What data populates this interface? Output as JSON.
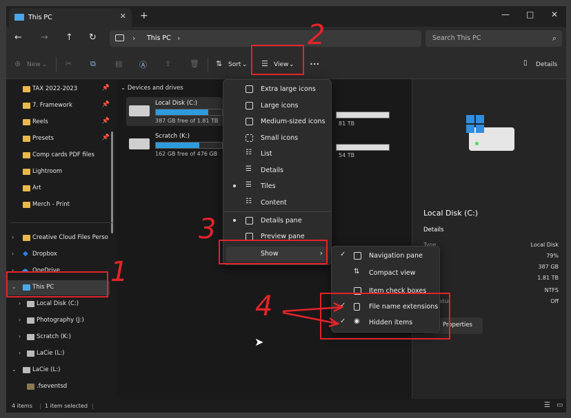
{
  "window": {
    "tab_title": "This PC",
    "new_tab": "+",
    "minimize": "—",
    "maximize": "□",
    "close": "✕"
  },
  "address": {
    "location": "This PC",
    "search_placeholder": "Search This PC"
  },
  "toolbar": {
    "new_label": "New",
    "sort_label": "Sort",
    "view_label": "View",
    "more_label": "•••",
    "details_label": "Details"
  },
  "nav": {
    "items": [
      {
        "label": "TAX 2022-2023",
        "pinned": true
      },
      {
        "label": "7. Framework",
        "pinned": true
      },
      {
        "label": "Reels",
        "pinned": true
      },
      {
        "label": "Presets",
        "pinned": true
      },
      {
        "label": "Comp cards PDF files",
        "pinned": false
      },
      {
        "label": "Lightroom",
        "pinned": false
      },
      {
        "label": "Art",
        "pinned": false
      },
      {
        "label": "Merch - Print",
        "pinned": false
      },
      {
        "label": "Creative Cloud Files Personal",
        "pinned": false
      },
      {
        "label": "Dropbox",
        "pinned": false
      },
      {
        "label": "OneDrive",
        "pinned": false
      },
      {
        "label": "This PC",
        "pinned": false
      },
      {
        "label": "Local Disk (C:)",
        "pinned": false
      },
      {
        "label": "Photography (J:)",
        "pinned": false
      },
      {
        "label": "Scratch (K:)",
        "pinned": false
      },
      {
        "label": "LaCie (L:)",
        "pinned": false
      },
      {
        "label": "LaCie (L:)",
        "pinned": false
      },
      {
        "label": ".fseventsd",
        "pinned": false
      }
    ]
  },
  "content": {
    "group_header": "Devices and drives",
    "drives": [
      {
        "name": "Local Disk (C:)",
        "free": "387 GB free of 1.81 TB",
        "used_fraction": 0.79
      },
      {
        "name": "Scratch (K:)",
        "free": "162 GB free of 476 GB",
        "used_fraction": 0.66
      }
    ],
    "partial_sizes": [
      "81 TB",
      "54 TB"
    ]
  },
  "view_menu": {
    "items": [
      {
        "label": "Extra large icons",
        "bullet": false
      },
      {
        "label": "Large icons",
        "bullet": false
      },
      {
        "label": "Medium-sized icons",
        "bullet": false
      },
      {
        "label": "Small icons",
        "bullet": false
      },
      {
        "label": "List",
        "bullet": false
      },
      {
        "label": "Details",
        "bullet": false
      },
      {
        "label": "Tiles",
        "bullet": true
      },
      {
        "label": "Content",
        "bullet": false
      },
      {
        "label": "Details pane",
        "bullet": true
      },
      {
        "label": "Preview pane",
        "bullet": false
      },
      {
        "label": "Show",
        "bullet": false
      }
    ]
  },
  "show_menu": {
    "items": [
      {
        "label": "Navigation pane",
        "checked": true
      },
      {
        "label": "Compact view",
        "checked": false
      },
      {
        "label": "Item check boxes",
        "checked": false
      },
      {
        "label": "File name extensions",
        "checked": true
      },
      {
        "label": "Hidden items",
        "checked": true
      }
    ]
  },
  "details_pane": {
    "title": "Local Disk (C:)",
    "section": "Details",
    "rows": [
      {
        "label": "Type",
        "value": "Local Disk"
      },
      {
        "label": "used",
        "value": "79%"
      },
      {
        "label": "free",
        "value": "387 GB"
      },
      {
        "label": "ze",
        "value": "1.81 TB"
      },
      {
        "label": "stem",
        "value": "NTFS"
      },
      {
        "label": "ker status",
        "value": "Off"
      }
    ],
    "properties_label": "Properties"
  },
  "status": {
    "count": "4 items",
    "selected": "1 item selected"
  },
  "annotations": [
    "1",
    "2",
    "3",
    "4"
  ],
  "colors": {
    "accent": "#2e9bde",
    "annotation": "#e4232a",
    "folder": "#e8b94a"
  }
}
